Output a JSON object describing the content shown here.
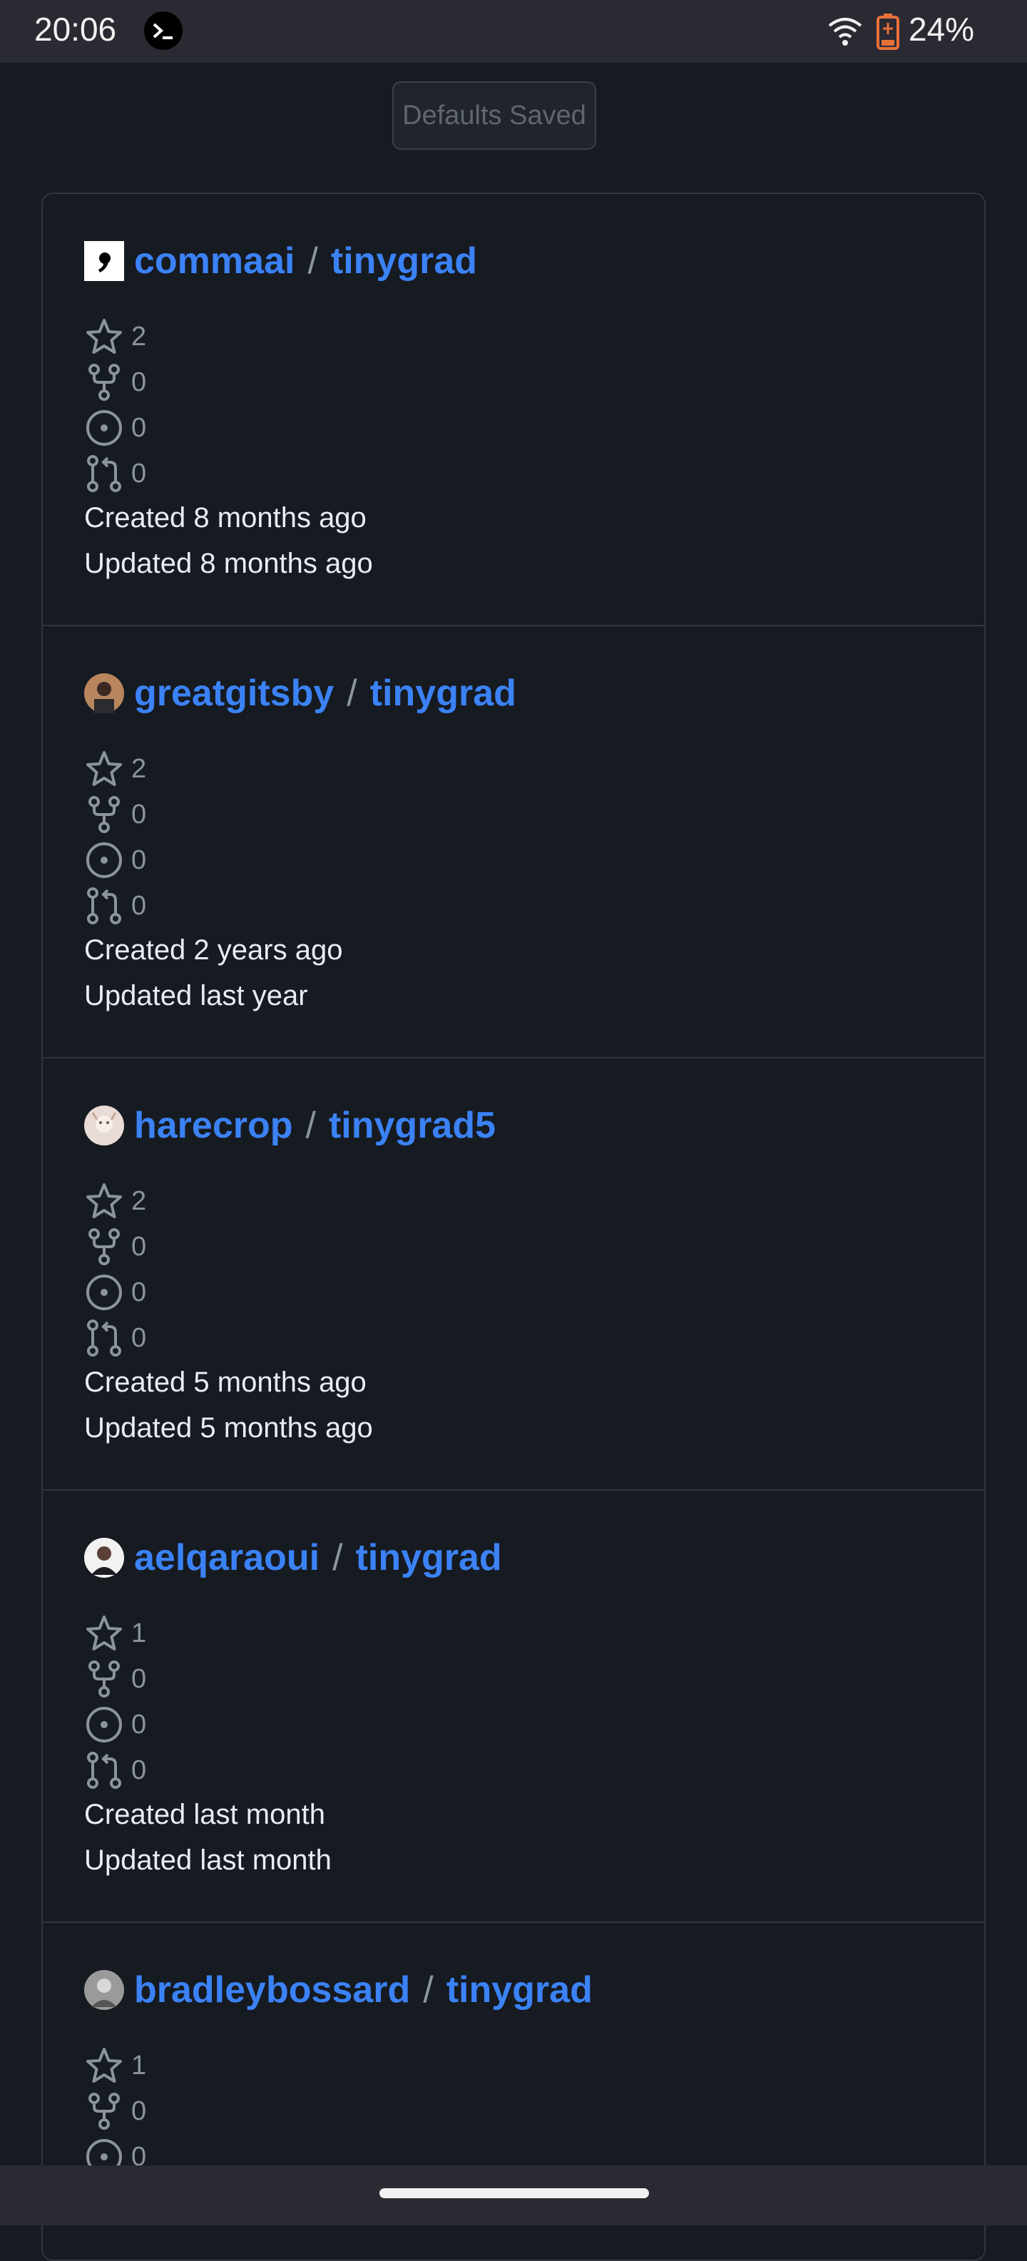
{
  "status_bar": {
    "time": "20:06",
    "battery": "24%"
  },
  "defaults_button": "Defaults Saved",
  "repos": [
    {
      "owner": "commaai",
      "name": "tinygrad",
      "stars": "2",
      "forks": "0",
      "issues": "0",
      "pulls": "0",
      "created": "Created 8 months ago",
      "updated": "Updated 8 months ago"
    },
    {
      "owner": "greatgitsby",
      "name": "tinygrad",
      "stars": "2",
      "forks": "0",
      "issues": "0",
      "pulls": "0",
      "created": "Created 2 years ago",
      "updated": "Updated last year"
    },
    {
      "owner": "harecrop",
      "name": "tinygrad5",
      "stars": "2",
      "forks": "0",
      "issues": "0",
      "pulls": "0",
      "created": "Created 5 months ago",
      "updated": "Updated 5 months ago"
    },
    {
      "owner": "aelqaraoui",
      "name": "tinygrad",
      "stars": "1",
      "forks": "0",
      "issues": "0",
      "pulls": "0",
      "created": "Created last month",
      "updated": "Updated last month"
    },
    {
      "owner": "bradleybossard",
      "name": "tinygrad",
      "stars": "1",
      "forks": "0",
      "issues": "0"
    }
  ],
  "colors": {
    "link": "#3b82f6",
    "muted": "#8b949e",
    "background": "#161a21"
  },
  "icons": [
    "star-icon",
    "fork-icon",
    "issue-icon",
    "pull-request-icon"
  ]
}
